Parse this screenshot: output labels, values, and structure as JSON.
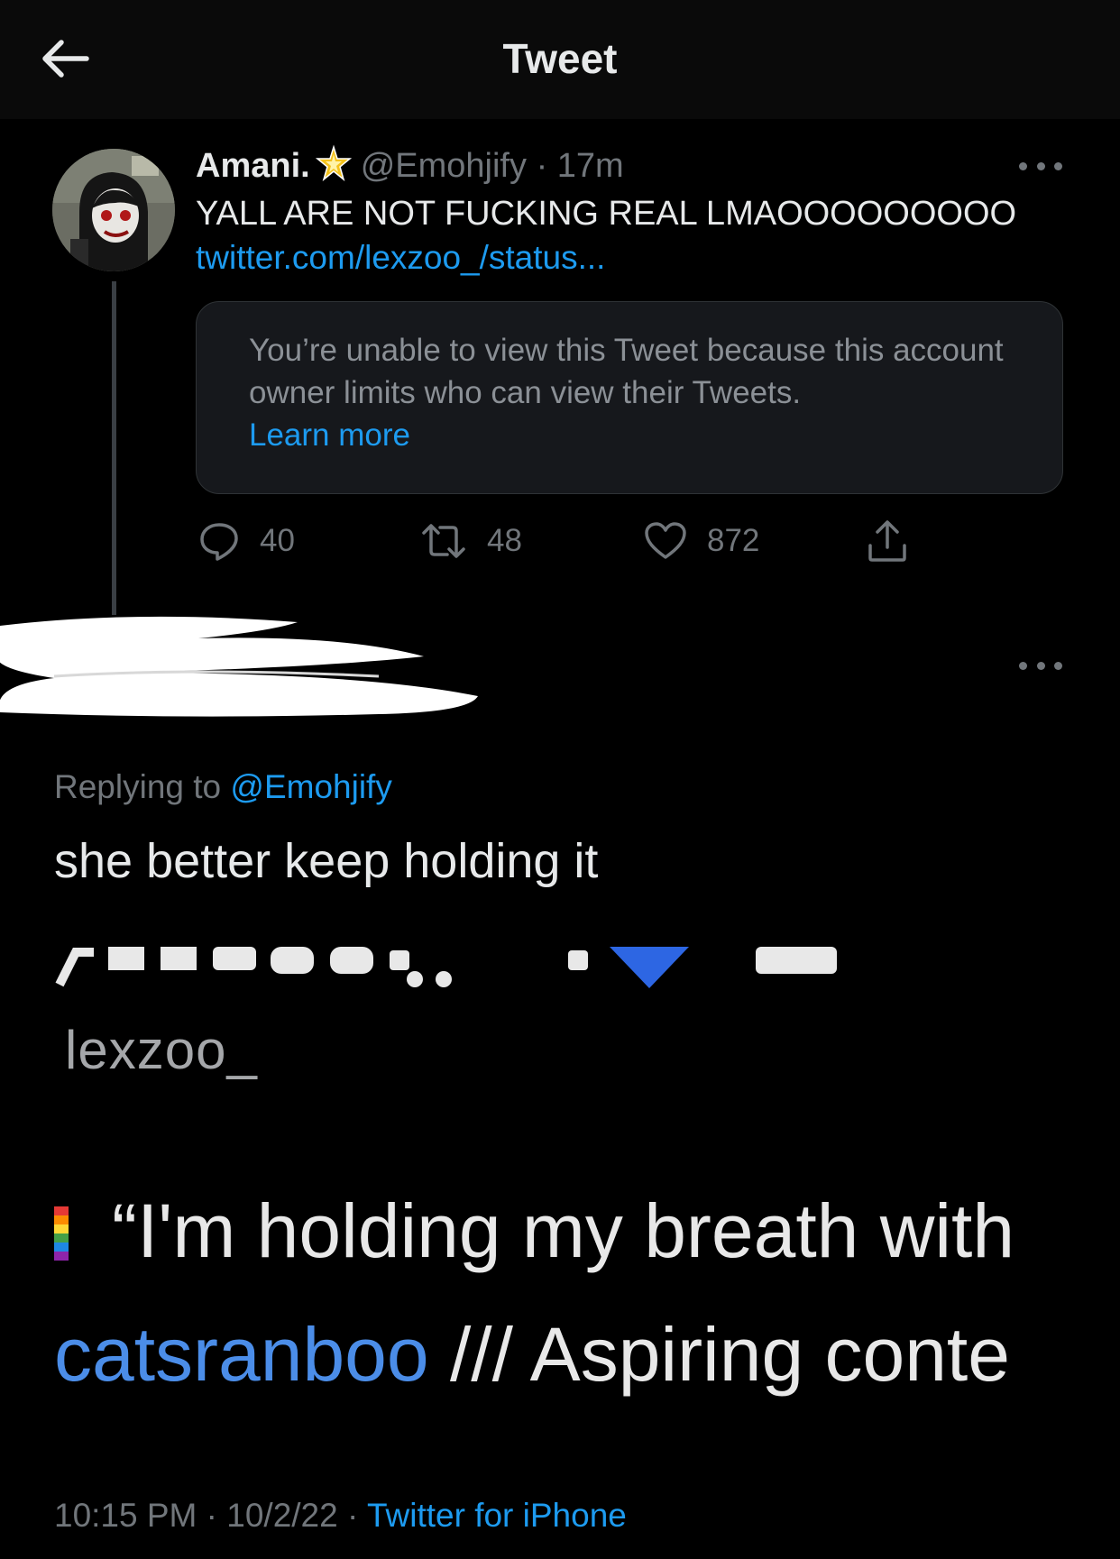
{
  "header": {
    "title": "Tweet",
    "back_icon": "arrow-left-icon"
  },
  "quoted_tweet": {
    "display_name": "Amani.",
    "badge_icon": "sparkle-star-icon",
    "handle": "@Emohjify",
    "separator": "·",
    "time": "17m",
    "text": "YALL ARE NOT FUCKING REAL LMAOOOOOOOOO",
    "link": "twitter.com/lexzoo_/status...",
    "unavailable_notice": "You’re unable to view this Tweet because this account owner limits who can view their Tweets.",
    "learn_more": "Learn more",
    "replies": "40",
    "retweets": "48",
    "likes": "872"
  },
  "reply": {
    "replying_prefix": "Replying to",
    "replying_handle": "@Emohjify",
    "text": "she better keep holding it",
    "media": {
      "handle_text": "lexzoo_",
      "quote_text": "“I'm holding my breath with",
      "bio_blue": "catsranboo",
      "bio_rest": " /// Aspiring conte"
    },
    "time": "10:15 PM",
    "separator": "·",
    "date": "10/2/22",
    "source": "Twitter for iPhone"
  },
  "colors": {
    "accent": "#1d9bf0",
    "muted": "#71767b",
    "background": "#000000"
  }
}
